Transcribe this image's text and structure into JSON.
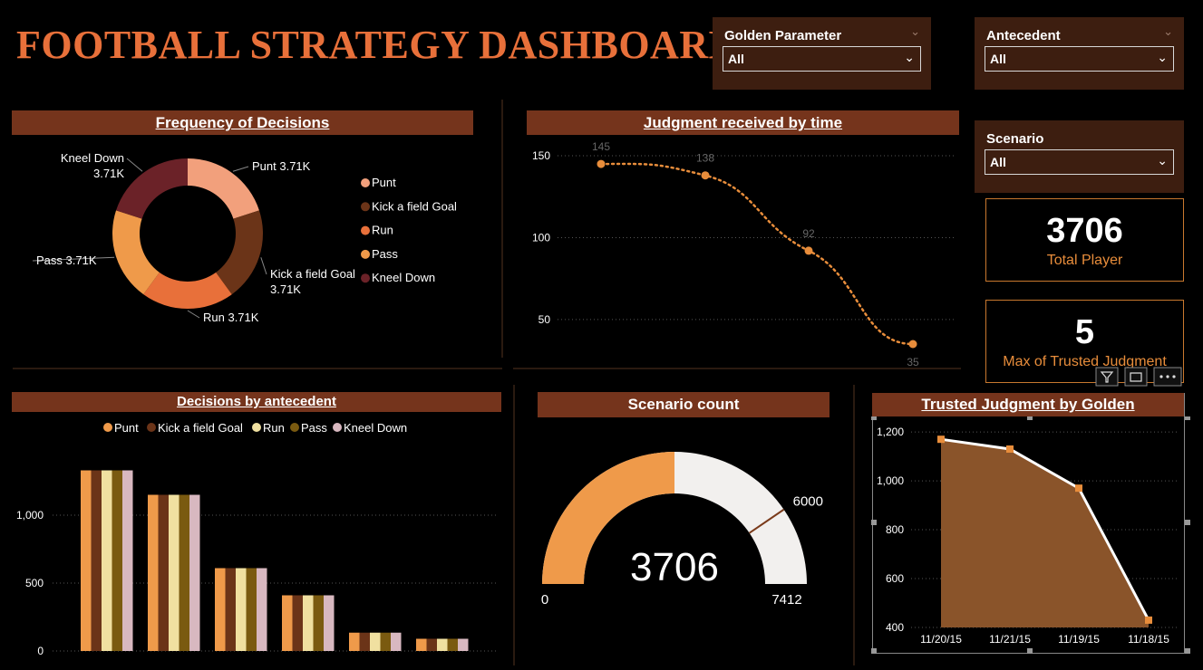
{
  "title": "FOOTBALL STRATEGY DASHBOARD",
  "slicers": {
    "golden": {
      "label": "Golden Parameter",
      "value": "All"
    },
    "antecedent": {
      "label": "Antecedent",
      "value": "All"
    },
    "scenario": {
      "label": "Scenario",
      "value": "All"
    }
  },
  "cards": {
    "total_player": {
      "value": "3706",
      "label": "Total Player"
    },
    "max_trusted": {
      "value": "5",
      "label": "Max of Trusted Judgment"
    }
  },
  "colors": {
    "punt": "#f2a07c",
    "kick": "#6b3418",
    "run": "#e8703a",
    "pass": "#ef9a4a",
    "kneel": "#6b2228",
    "accent": "#e88d3b"
  },
  "chart_data": [
    {
      "type": "pie",
      "title": "Frequency of Decisions",
      "labels": [
        "Punt",
        "Kick a field Goal",
        "Run",
        "Pass",
        "Kneel Down"
      ],
      "values": [
        3706,
        3706,
        3706,
        3706,
        3706
      ],
      "data_labels": [
        "Punt 3.71K",
        "Kick a field Goal 3.71K",
        "Run 3.71K",
        "Pass 3.71K",
        "Kneel Down 3.71K"
      ],
      "legend": "right"
    },
    {
      "type": "line",
      "title": "Judgment received by time",
      "x": [
        1,
        2,
        3,
        4
      ],
      "values": [
        145,
        138,
        92,
        35
      ],
      "y_ticks": [
        "50",
        "100",
        "150"
      ],
      "ylim": [
        35,
        155
      ]
    },
    {
      "type": "bar",
      "title": "Decisions by antecedent",
      "series_names": [
        "Punt",
        "Kick a field Goal",
        "Run",
        "Pass",
        "Kneel Down"
      ],
      "series_colors": [
        "#ef9a4a",
        "#6b3418",
        "#f0e0a0",
        "#7a5a10",
        "#d8b8c0"
      ],
      "groups": [
        1330,
        1150,
        610,
        410,
        135,
        90
      ],
      "y_ticks": [
        "0",
        "500",
        "1,000"
      ],
      "ylim": [
        0,
        1400
      ],
      "legend": "top"
    },
    {
      "type": "gauge",
      "title": "Scenario count",
      "value": 3706,
      "value_label": "3706",
      "min": 0,
      "min_label": "0",
      "max": 7412,
      "max_label": "7412",
      "target": 6000,
      "target_label": "6000"
    },
    {
      "type": "area",
      "title": "Trusted Judgment by Golden",
      "categories": [
        "11/20/15",
        "11/21/15",
        "11/19/15",
        "11/18/15"
      ],
      "values": [
        1170,
        1130,
        970,
        430
      ],
      "y_ticks": [
        "400",
        "600",
        "800",
        "1,000",
        "1,200"
      ],
      "ylim": [
        400,
        1230
      ]
    }
  ]
}
